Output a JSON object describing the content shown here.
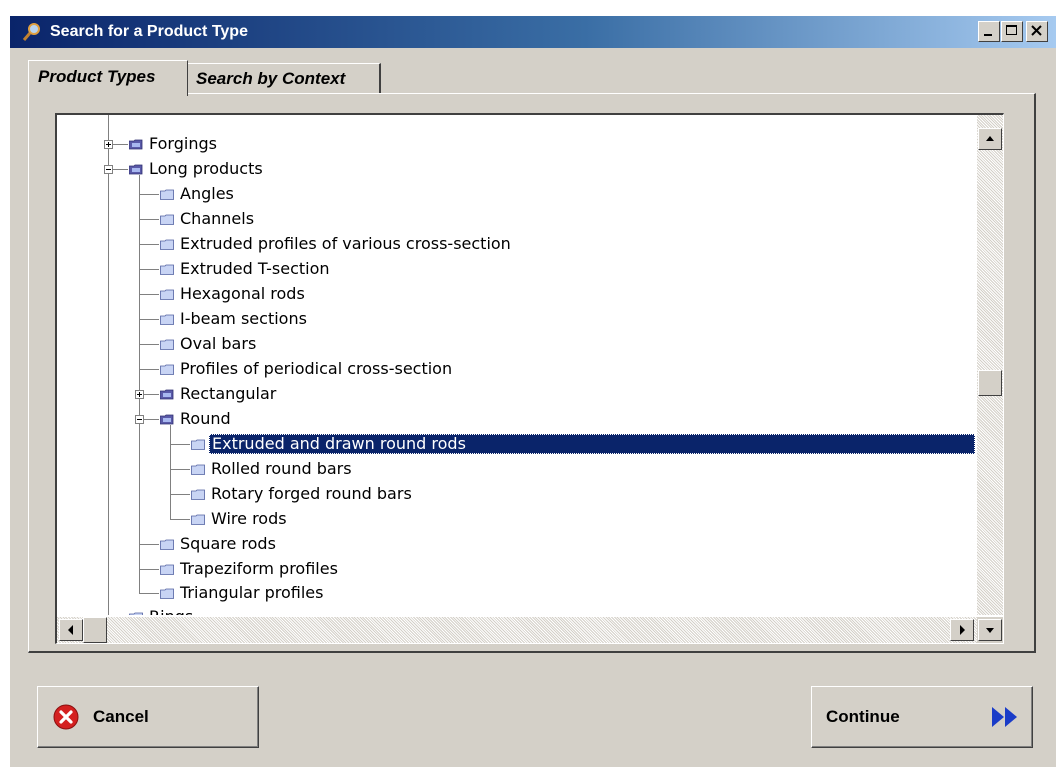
{
  "window": {
    "title": "Search for a Product Type",
    "controls": [
      "minimize",
      "maximize",
      "close"
    ]
  },
  "tabs": [
    {
      "label": "Product Types",
      "active": true
    },
    {
      "label": "Search by Context",
      "active": false
    }
  ],
  "tree": {
    "items": [
      {
        "label": "Forgings",
        "level": 1,
        "type": "branch",
        "expanded": false
      },
      {
        "label": "Long products",
        "level": 1,
        "type": "branch",
        "expanded": true
      },
      {
        "label": "Angles",
        "level": 2,
        "type": "leaf"
      },
      {
        "label": "Channels",
        "level": 2,
        "type": "leaf"
      },
      {
        "label": "Extruded profiles of various cross-section",
        "level": 2,
        "type": "leaf"
      },
      {
        "label": "Extruded T-section",
        "level": 2,
        "type": "leaf"
      },
      {
        "label": "Hexagonal rods",
        "level": 2,
        "type": "leaf"
      },
      {
        "label": "I-beam sections",
        "level": 2,
        "type": "leaf"
      },
      {
        "label": "Oval bars",
        "level": 2,
        "type": "leaf"
      },
      {
        "label": "Profiles of periodical cross-section",
        "level": 2,
        "type": "leaf"
      },
      {
        "label": "Rectangular",
        "level": 2,
        "type": "branch",
        "expanded": false
      },
      {
        "label": "Round",
        "level": 2,
        "type": "branch",
        "expanded": true
      },
      {
        "label": "Extruded and drawn round rods",
        "level": 3,
        "type": "leaf",
        "selected": true
      },
      {
        "label": "Rolled round bars",
        "level": 3,
        "type": "leaf"
      },
      {
        "label": "Rotary forged round bars",
        "level": 3,
        "type": "leaf"
      },
      {
        "label": "Wire rods",
        "level": 3,
        "type": "leaf"
      },
      {
        "label": "Square rods",
        "level": 2,
        "type": "leaf"
      },
      {
        "label": "Trapeziform profiles",
        "level": 2,
        "type": "leaf"
      },
      {
        "label": "Triangular profiles",
        "level": 2,
        "type": "leaf"
      },
      {
        "label": "Rings",
        "level": 1,
        "type": "leaf",
        "partially_visible": true
      }
    ],
    "selected_label": "Extruded and drawn round rods",
    "vertical_scroll_fraction": 0.57
  },
  "buttons": {
    "cancel": {
      "label": "Cancel",
      "icon": "cancel-x-icon"
    },
    "continue": {
      "label": "Continue",
      "icon": "double-arrow-right-icon"
    }
  },
  "colors": {
    "titlebar_start": "#0a246a",
    "titlebar_end": "#a6caf0",
    "selection": "#0a246a",
    "folder_closed": "#5a5aa8",
    "cancel_red": "#d42020",
    "continue_arrow": "#1a3cc8"
  }
}
